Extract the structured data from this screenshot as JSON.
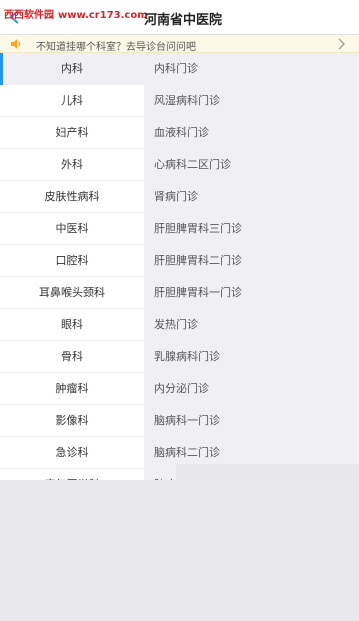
{
  "header": {
    "watermark_cn": "西西软件园",
    "watermark_url": "www.cr173.com",
    "title": "河南省中医院"
  },
  "notice": {
    "text": "不知道挂哪个科室？去导诊台问问吧"
  },
  "departments": [
    "内科",
    "儿科",
    "妇产科",
    "外科",
    "皮肤性病科",
    "中医科",
    "口腔科",
    "耳鼻喉头颈科",
    "眼科",
    "骨科",
    "肿瘤科",
    "影像科",
    "急诊科",
    "康复医学科"
  ],
  "clinics": [
    "内科门诊",
    "风湿病科门诊",
    "血液科门诊",
    "心病科二区门诊",
    "肾病门诊",
    "肝胆脾胃科三门诊",
    "肝胆脾胃科二门诊",
    "肝胆脾胃科一门诊",
    "发热门诊",
    "乳腺病科门诊",
    "内分泌门诊",
    "脑病科一门诊",
    "脑病科二门诊",
    "肺病"
  ],
  "colors": {
    "accent": "#2196f3",
    "watermark": "#d4262a",
    "notice_bg": "#fdf9e8",
    "speaker": "#f5a623"
  }
}
